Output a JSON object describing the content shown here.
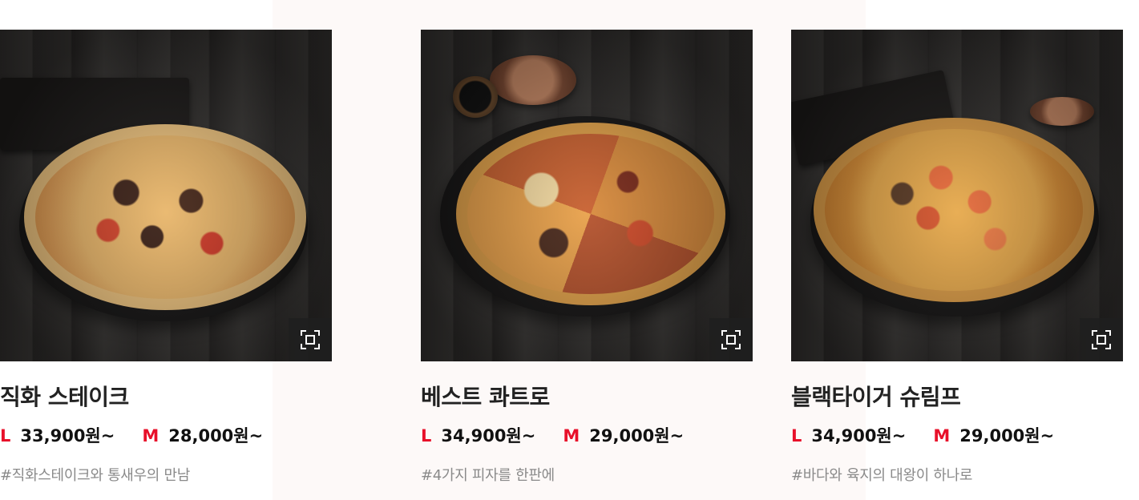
{
  "products": [
    {
      "name": "베스트 콰트로",
      "prices": [
        {
          "size": "L",
          "price": "34,900원~"
        },
        {
          "size": "M",
          "price": "29,000원~"
        }
      ],
      "tagline": "#4가지 피자를 한판에",
      "image_icon": "pizza-photo",
      "zoom_icon": "expand-icon"
    },
    {
      "name": "블랙타이거 슈림프",
      "prices": [
        {
          "size": "L",
          "price": "34,900원~"
        },
        {
          "size": "M",
          "price": "29,000원~"
        }
      ],
      "tagline": "#바다와 육지의 대왕이 하나로",
      "image_icon": "pizza-photo",
      "zoom_icon": "expand-icon"
    },
    {
      "name": "직화 스테이크",
      "prices": [
        {
          "size": "L",
          "price": "33,900원~"
        },
        {
          "size": "M",
          "price": "28,000원~"
        }
      ],
      "tagline": "#직화스테이크와 통새우의 만남",
      "image_icon": "pizza-photo",
      "zoom_icon": "expand-icon"
    }
  ],
  "colors": {
    "size_label": "#e8102a",
    "title": "#222222",
    "tagline": "#8a8a8a",
    "background_panel": "#fdf9f8"
  }
}
